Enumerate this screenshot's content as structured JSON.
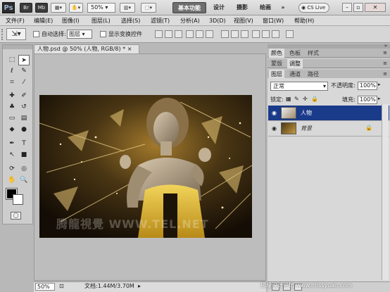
{
  "appbar": {
    "logo": "Ps",
    "br_label": "Br",
    "mb_label": "Mb",
    "zoom": "50%",
    "workspaces": [
      "基本功能",
      "设计",
      "摄影",
      "绘画",
      "»"
    ],
    "cslive": "CS Live"
  },
  "menubar": [
    "文件(F)",
    "编辑(E)",
    "图像(I)",
    "图层(L)",
    "选择(S)",
    "滤镜(T)",
    "分析(A)",
    "3D(D)",
    "视图(V)",
    "窗口(W)",
    "帮助(H)"
  ],
  "options": {
    "auto_select_label": "自动选择:",
    "auto_select_value": "图层",
    "show_transform_label": "显示变换控件"
  },
  "document": {
    "tab_title": "人物.psd @ 50% (人物, RGB/8) *",
    "status_zoom": "50%",
    "status_doc": "文档:1.44M/3.70M",
    "watermark": "腾龍視覺 WWW.TEL.NET"
  },
  "panels": {
    "row1": [
      "颜色",
      "色板",
      "样式"
    ],
    "row2": [
      "蒙版",
      "调整"
    ],
    "row3": [
      "图层",
      "通道",
      "路径"
    ],
    "blend_mode": "正常",
    "opacity_label": "不透明度:",
    "opacity": "100%",
    "lock_label": "锁定:",
    "fill_label": "填充:",
    "fill": "100%",
    "layers": [
      {
        "name": "人物",
        "selected": true
      },
      {
        "name": "背景",
        "selected": false,
        "locked": true
      }
    ]
  },
  "site_watermark": "思缘设计论坛 www.missyuan.com",
  "colors": {
    "selection": "#1a3a8a",
    "foreground": "#000000",
    "background": "#ffffff"
  }
}
